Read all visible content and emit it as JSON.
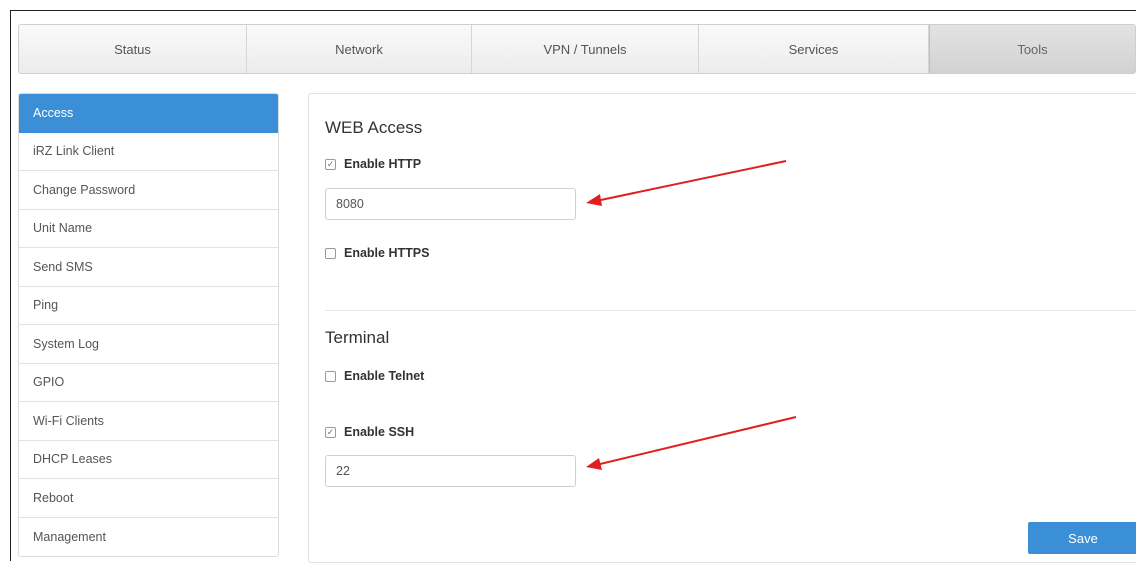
{
  "tabs": [
    {
      "label": "Status",
      "active": false
    },
    {
      "label": "Network",
      "active": false
    },
    {
      "label": "VPN / Tunnels",
      "active": false
    },
    {
      "label": "Services",
      "active": false
    },
    {
      "label": "Tools",
      "active": true
    }
  ],
  "sidebar": {
    "items": [
      {
        "label": "Access",
        "active": true
      },
      {
        "label": "iRZ Link Client"
      },
      {
        "label": "Change Password"
      },
      {
        "label": "Unit Name"
      },
      {
        "label": "Send SMS"
      },
      {
        "label": "Ping"
      },
      {
        "label": "System Log"
      },
      {
        "label": "GPIO"
      },
      {
        "label": "Wi-Fi Clients"
      },
      {
        "label": "DHCP Leases"
      },
      {
        "label": "Reboot"
      },
      {
        "label": "Management"
      }
    ]
  },
  "web_access": {
    "title": "WEB Access",
    "http": {
      "label": "Enable HTTP",
      "checked": true,
      "port": "8080"
    },
    "https": {
      "label": "Enable HTTPS",
      "checked": false
    }
  },
  "terminal": {
    "title": "Terminal",
    "telnet": {
      "label": "Enable Telnet",
      "checked": false
    },
    "ssh": {
      "label": "Enable SSH",
      "checked": true,
      "port": "22"
    }
  },
  "save_label": "Save",
  "colors": {
    "accent": "#3b8fd6",
    "annotation_arrow": "#e02020"
  }
}
